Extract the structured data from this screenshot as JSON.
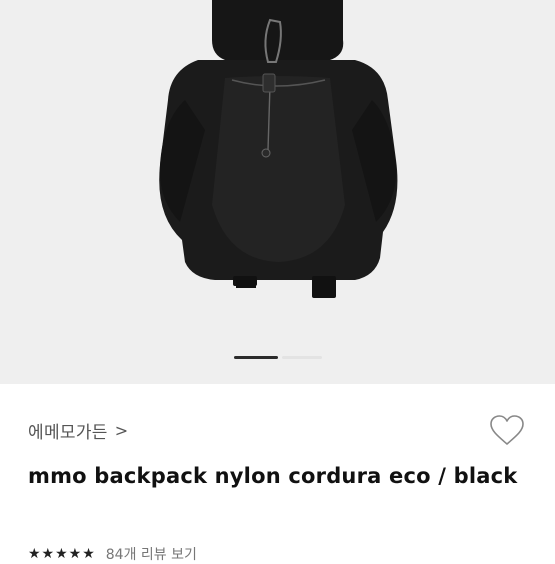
{
  "product": {
    "brand": "에메모가든",
    "brand_chevron": ">",
    "title": "mmo backpack nylon cordura eco / black",
    "stars": "★★★★★",
    "reviews": "84개 리뷰 보기"
  },
  "gallery": {
    "current_page": 1
  },
  "icons": {
    "like": "heart-outline-icon",
    "chevron": "chevron-right-icon"
  },
  "colors": {
    "gallery_bg": "#efefef",
    "backpack": "#1b1b1b",
    "pager_active": "#2b2b2b"
  }
}
